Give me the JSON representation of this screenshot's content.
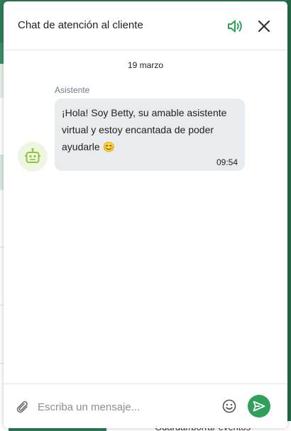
{
  "header": {
    "title": "Chat de atención al cliente",
    "sound_icon": "speaker-volume-icon",
    "close_icon": "close-icon"
  },
  "conversation": {
    "date_separator": "19 marzo",
    "messages": [
      {
        "sender": "Asistente",
        "text": "¡Hola! Soy Betty, su amable asistente virtual y estoy encantada de poder ayudarle 😊",
        "time": "09:54",
        "avatar_icon": "robot-icon"
      }
    ]
  },
  "composer": {
    "placeholder": "Escriba un mensaje...",
    "attach_icon": "paperclip-icon",
    "emoji_icon": "smiley-icon",
    "send_icon": "send-icon"
  },
  "background": {
    "footer_text": "Guardar/borrar eventos"
  },
  "colors": {
    "accent": "#2ea05a",
    "bubble": "#e9ecef",
    "sender_label": "#6d7b86"
  }
}
